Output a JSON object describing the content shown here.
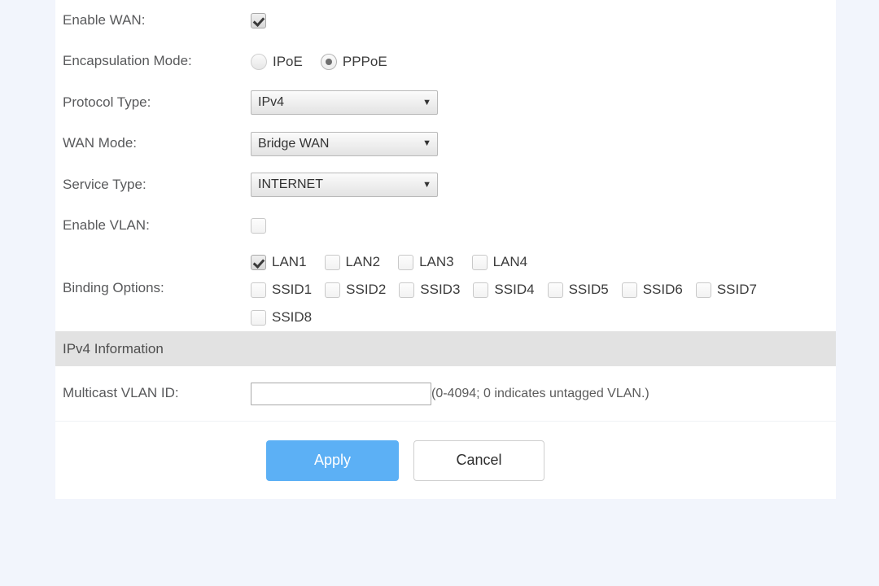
{
  "theme": {
    "page_background": "#f2f5fc",
    "card_background": "#ffffff",
    "section_band": "#e2e2e2",
    "accent": "#5cb0f5",
    "label_color": "#58595b"
  },
  "form": {
    "enable_wan": {
      "label": "Enable WAN:",
      "checked": true
    },
    "encapsulation_mode": {
      "label": "Encapsulation Mode:",
      "options": [
        {
          "label": "IPoE",
          "selected": false
        },
        {
          "label": "PPPoE",
          "selected": true
        }
      ]
    },
    "protocol_type": {
      "label": "Protocol Type:",
      "value": "IPv4",
      "caret": "▼"
    },
    "wan_mode": {
      "label": "WAN Mode:",
      "value": "Bridge WAN",
      "caret": "▼"
    },
    "service_type": {
      "label": "Service Type:",
      "value": "INTERNET",
      "caret": "▼"
    },
    "enable_vlan": {
      "label": "Enable VLAN:",
      "checked": false
    },
    "binding_options": {
      "label": "Binding Options:",
      "items": [
        {
          "label": "LAN1",
          "checked": true
        },
        {
          "label": "LAN2",
          "checked": false
        },
        {
          "label": "LAN3",
          "checked": false
        },
        {
          "label": "LAN4",
          "checked": false
        },
        {
          "label": "SSID1",
          "checked": false
        },
        {
          "label": "SSID2",
          "checked": false
        },
        {
          "label": "SSID3",
          "checked": false
        },
        {
          "label": "SSID4",
          "checked": false
        },
        {
          "label": "SSID5",
          "checked": false
        },
        {
          "label": "SSID6",
          "checked": false
        },
        {
          "label": "SSID7",
          "checked": false
        },
        {
          "label": "SSID8",
          "checked": false
        }
      ]
    }
  },
  "ipv4_section": {
    "title": "IPv4 Information",
    "multicast_vlan_id": {
      "label": "Multicast VLAN ID:",
      "value": "",
      "placeholder": "",
      "hint": "(0-4094; 0 indicates untagged VLAN.)"
    }
  },
  "footer": {
    "apply_label": "Apply",
    "cancel_label": "Cancel"
  }
}
